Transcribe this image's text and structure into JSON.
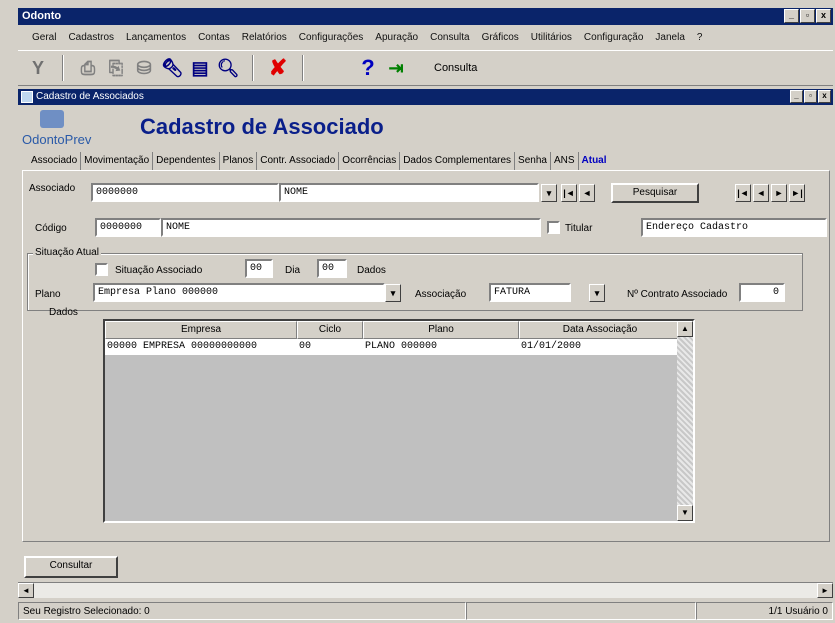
{
  "window": {
    "title": "Odonto",
    "controls": [
      "_",
      "▫",
      "x"
    ]
  },
  "menu": [
    "Geral",
    "Cadastros",
    "Lançamentos",
    "Contas",
    "Relatórios",
    "Configurações",
    "Apuração",
    "Consulta",
    "Gráficos",
    "Utilitários",
    "Configuração",
    "Janela",
    "?"
  ],
  "toolbar": {
    "icons": [
      "filter-icon",
      "print-icon",
      "print-preview-icon",
      "export-icon",
      "find-icon",
      "list-icon",
      "zoom-icon",
      "delete-icon",
      "help-icon",
      "exit-icon"
    ],
    "consulta_label": "Consulta"
  },
  "subwindow": {
    "title": "Cadastro de Associados",
    "controls": [
      "_",
      "▫",
      "x"
    ]
  },
  "logo": {
    "text": "OdontoPrev"
  },
  "form": {
    "title": "Cadastro de Associado",
    "tabs": [
      "Associado",
      "Movimentação",
      "Dependentes",
      "Planos",
      "Contr. Associado",
      "Ocorrências",
      "Dados Complementares",
      "Senha",
      "ANS",
      "Atual"
    ],
    "associado_label": "Associado",
    "associado_code": "0000000",
    "associado_name": "NOME",
    "btn_first": "|◄",
    "btn_prev": "◄",
    "btn_next": "►",
    "btn_last": "►|",
    "search_button": "Pesquisar",
    "codigo_label": "Código",
    "codigo_value": "0000000",
    "codigo_name": "NOME",
    "titular_check_label": "Titular",
    "titular_value": "Endereço Cadastro",
    "group_label": "Situação Atual",
    "check_label": "Situação Associado",
    "periodo_start": "00",
    "periodo_mid_label": "Dia",
    "periodo_end": "00",
    "periodo_end_label": "Dados",
    "plano_label": "Plano",
    "plano_value": "Empresa Plano 000000",
    "associacao_label": "Associação",
    "associacao_value": "FATURA",
    "contrato_label": "Nº Contrato Associado",
    "contrato_value": "0",
    "dados_label": "Dados",
    "grid_headers": [
      "Empresa",
      "Ciclo",
      "Plano",
      "Data Associação"
    ],
    "grid_rows": [
      [
        "00000 EMPRESA 00000000000",
        "00",
        "PLANO 000000",
        "01/01/2000"
      ]
    ],
    "bottom_button": "Consultar"
  },
  "statusbar": {
    "left": "Seu Registro Selecionado: 0",
    "right": "1/1 Usuário 0"
  }
}
